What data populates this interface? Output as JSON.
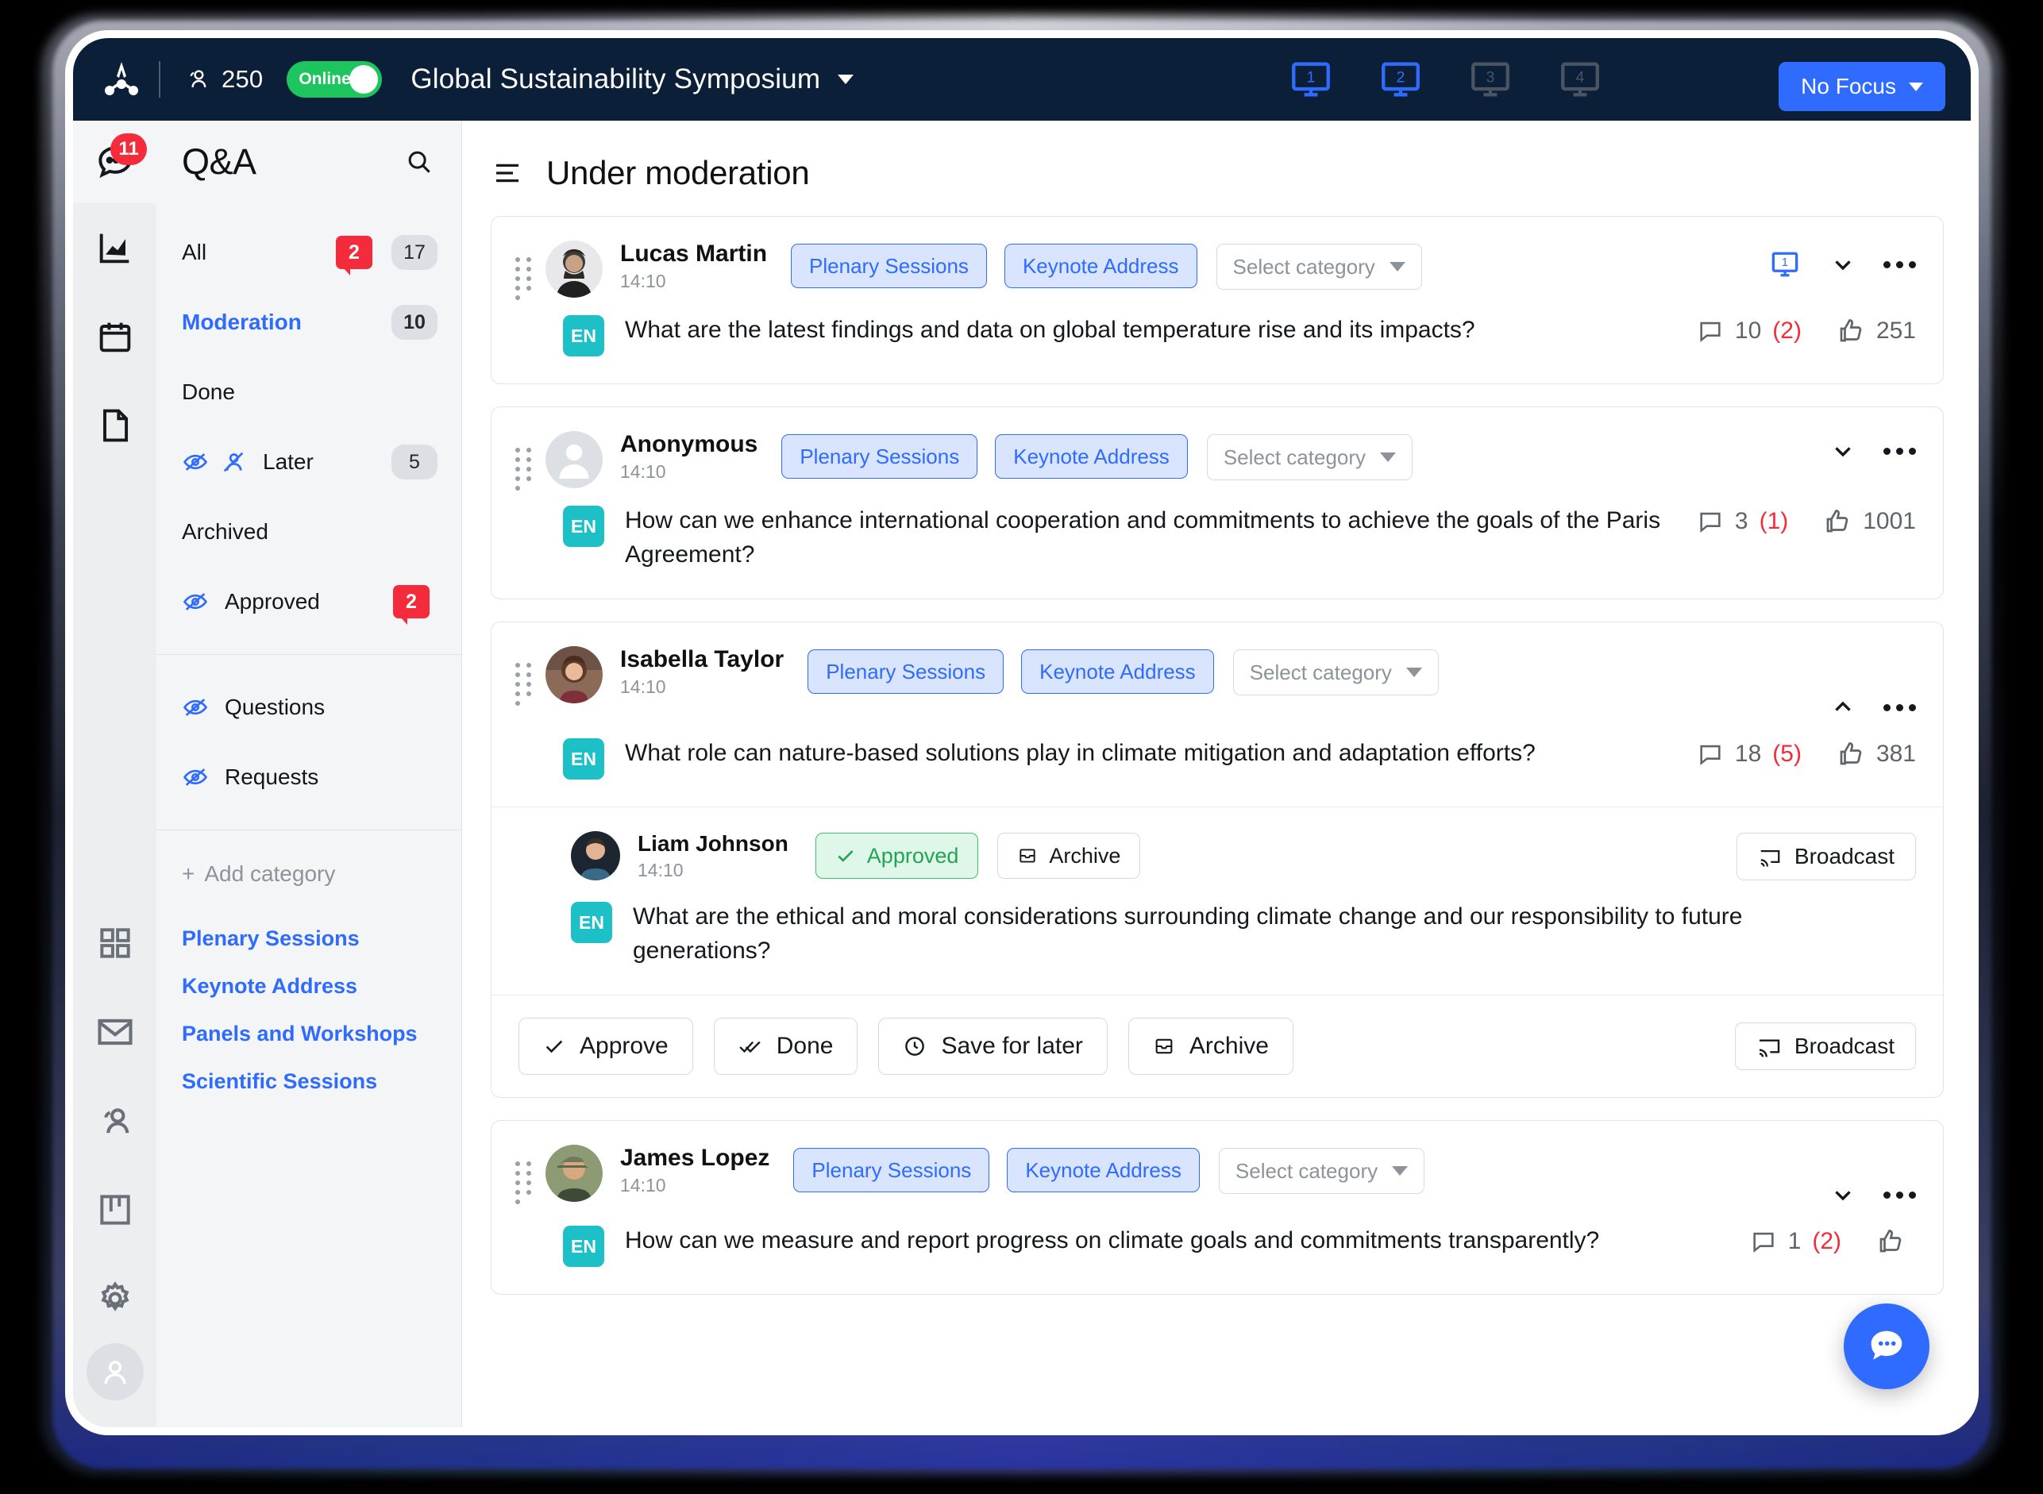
{
  "topbar": {
    "logo_icon": "logo-icon",
    "attendees_icon": "attendees-icon",
    "attendees_count": "250",
    "online_label": "Online",
    "event_title": "Global Sustainability Symposium",
    "screens": [
      {
        "number": "1",
        "state": "active"
      },
      {
        "number": "2",
        "state": "active"
      },
      {
        "number": "3",
        "state": "inactive"
      },
      {
        "number": "4",
        "state": "inactive"
      }
    ],
    "focus_label": "No Focus",
    "accent_blue": "#2f6bff",
    "bar_bg": "#0b2038",
    "online_green": "#1ec45e"
  },
  "rail": {
    "chat_badge": "11",
    "items": [
      {
        "name": "chat-icon"
      },
      {
        "name": "analytics-icon"
      },
      {
        "name": "calendar-icon"
      },
      {
        "name": "document-icon"
      },
      {
        "name": "grid-icon"
      },
      {
        "name": "mail-icon"
      },
      {
        "name": "people-icon"
      },
      {
        "name": "board-icon"
      },
      {
        "name": "gear-icon"
      },
      {
        "name": "profile-avatar"
      }
    ]
  },
  "panel": {
    "title": "Q&A",
    "search_icon": "search-icon",
    "nav": [
      {
        "label": "All",
        "red_badge": "2",
        "gray_badge": "17",
        "active": false,
        "icons": []
      },
      {
        "label": "Moderation",
        "red_badge": "",
        "gray_badge": "10",
        "active": true,
        "icons": []
      },
      {
        "label": "Done",
        "red_badge": "",
        "gray_badge": "",
        "active": false,
        "icons": []
      },
      {
        "label": "Later",
        "red_badge": "",
        "gray_badge": "5",
        "active": false,
        "icons": [
          "eye-off-icon",
          "person-off-icon"
        ]
      },
      {
        "label": "Archived",
        "red_badge": "",
        "gray_badge": "",
        "active": false,
        "icons": []
      },
      {
        "label": "Approved",
        "red_badge": "2",
        "gray_badge": "",
        "active": false,
        "icons": [
          "eye-off-icon"
        ]
      }
    ],
    "nav2": [
      {
        "label": "Questions",
        "icons": [
          "eye-off-icon"
        ]
      },
      {
        "label": "Requests",
        "icons": [
          "eye-off-icon"
        ]
      }
    ],
    "add_category": "Add category",
    "categories": [
      "Plenary Sessions",
      "Keynote Address",
      "Panels and Workshops",
      "Scientific Sessions"
    ],
    "category_color": "#2f6bff"
  },
  "main": {
    "list_icon": "list-icon",
    "title": "Under moderation",
    "select_category_placeholder": "Select category",
    "lang_badge": "EN",
    "cards": [
      {
        "author": "Lucas Martin",
        "time": "14:10",
        "avatar": "avatar-lucas",
        "tags": [
          "Plenary Sessions",
          "Keynote Address"
        ],
        "select_category": "Select category",
        "screen_badge": "1",
        "chevron": "chevron-down-icon",
        "question": "What are the latest findings and data on global temperature rise and its impacts?",
        "comments": "10",
        "comments_new": "(2)",
        "likes": "251"
      },
      {
        "author": "Anonymous",
        "time": "14:10",
        "avatar": "avatar-anonymous",
        "tags": [
          "Plenary Sessions",
          "Keynote Address"
        ],
        "select_category": "Select category",
        "screen_badge": "",
        "chevron": "chevron-down-icon",
        "question": "How can we enhance international cooperation and commitments to achieve the goals of the Paris Agreement?",
        "comments": "3",
        "comments_new": "(1)",
        "likes": "1001"
      },
      {
        "author": "Isabella Taylor",
        "time": "14:10",
        "avatar": "avatar-isabella",
        "tags": [
          "Plenary Sessions",
          "Keynote Address"
        ],
        "select_category": "Select category",
        "screen_badge": "",
        "chevron": "chevron-up-icon",
        "question": "What role can nature-based solutions play in climate mitigation and adaptation efforts?",
        "comments": "18",
        "comments_new": "(5)",
        "likes": "381",
        "reply": {
          "author": "Liam Johnson",
          "time": "14:10",
          "avatar": "avatar-liam",
          "approved_label": "Approved",
          "archive_label": "Archive",
          "broadcast_label": "Broadcast",
          "text": "What are the ethical and moral considerations surrounding climate change and our responsibility to future generations?"
        },
        "actions": {
          "approve": "Approve",
          "done": "Done",
          "save_for_later": "Save for later",
          "archive": "Archive",
          "broadcast": "Broadcast"
        }
      },
      {
        "author": "James Lopez",
        "time": "14:10",
        "avatar": "avatar-james",
        "tags": [
          "Plenary Sessions",
          "Keynote Address"
        ],
        "select_category": "Select category",
        "screen_badge": "",
        "chevron": "chevron-down-icon",
        "question": "How can we measure and report progress on climate goals and commitments transparently?",
        "comments": "1",
        "comments_new": "(2)",
        "likes": ""
      }
    ]
  },
  "fab": {
    "icon": "chat-bubble-icon",
    "color": "#2f6bff"
  }
}
